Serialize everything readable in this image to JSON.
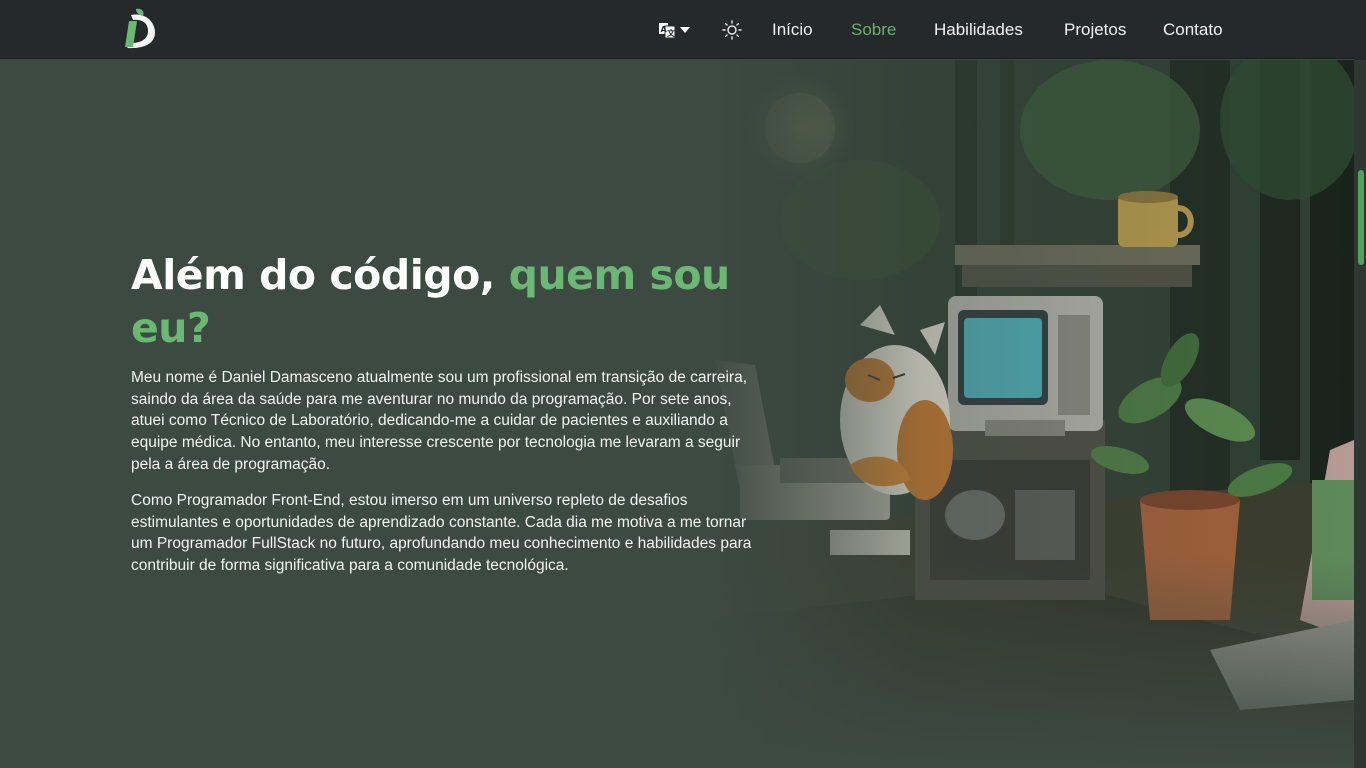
{
  "nav": {
    "logo_letter": "D",
    "links": [
      {
        "label": "Início",
        "active": false
      },
      {
        "label": "Sobre",
        "active": true
      },
      {
        "label": "Habilidades",
        "active": false
      },
      {
        "label": "Projetos",
        "active": false
      },
      {
        "label": "Contato",
        "active": false
      }
    ],
    "language_icon": "translate-icon",
    "theme_icon": "sun-icon"
  },
  "about": {
    "title_part1": "Além do código, ",
    "title_part2": "quem sou eu?",
    "paragraph1": "Meu nome é Daniel Damasceno atualmente sou um profissional em transição de carreira, saindo da área da saúde para me aventurar no mundo da programação. Por sete anos, atuei como Técnico de Laboratório, dedicando-me a cuidar de pacientes e auxiliando a equipe médica. No entanto, meu interesse crescente por tecnologia me levaram a seguir pela a área de programação.",
    "paragraph2": "Como Programador Front-End, estou imerso em um universo repleto de desafios estimulantes e oportunidades de aprendizado constante. Cada dia me motiva a me tornar um Programador FullStack no futuro, aprofundando meu conhecimento e habilidades para contribuir de forma significativa para a comunidade tecnológica."
  },
  "colors": {
    "nav_bg": "#25292c",
    "page_bg": "#3d4a42",
    "accent": "#6ab873",
    "text": "#f2f4f3"
  }
}
